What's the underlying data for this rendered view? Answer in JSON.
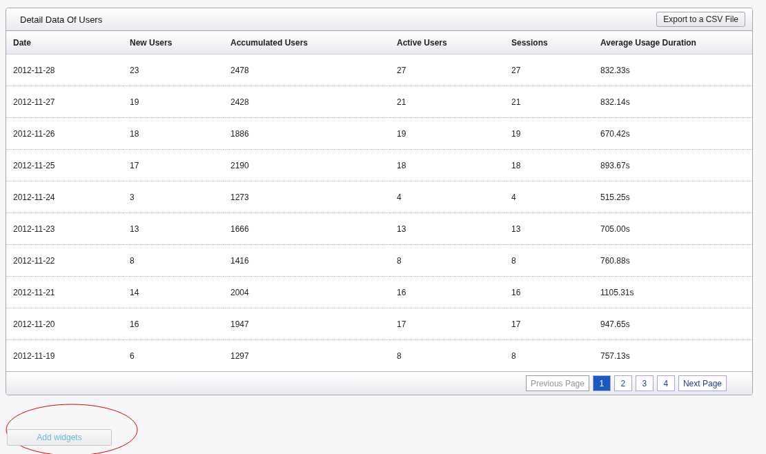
{
  "panel": {
    "title": "Detail Data Of Users",
    "export_button": "Export to a CSV File"
  },
  "table": {
    "columns": [
      "Date",
      "New Users",
      "Accumulated Users",
      "Active Users",
      "Sessions",
      "Average Usage Duration"
    ],
    "rows": [
      [
        "2012-11-28",
        "23",
        "2478",
        "27",
        "27",
        "832.33s"
      ],
      [
        "2012-11-27",
        "19",
        "2428",
        "21",
        "21",
        "832.14s"
      ],
      [
        "2012-11-26",
        "18",
        "1886",
        "19",
        "19",
        "670.42s"
      ],
      [
        "2012-11-25",
        "17",
        "2190",
        "18",
        "18",
        "893.67s"
      ],
      [
        "2012-11-24",
        "3",
        "1273",
        "4",
        "4",
        "515.25s"
      ],
      [
        "2012-11-23",
        "13",
        "1666",
        "13",
        "13",
        "705.00s"
      ],
      [
        "2012-11-22",
        "8",
        "1416",
        "8",
        "8",
        "760.88s"
      ],
      [
        "2012-11-21",
        "14",
        "2004",
        "16",
        "16",
        "1105.31s"
      ],
      [
        "2012-11-20",
        "16",
        "1947",
        "17",
        "17",
        "947.65s"
      ],
      [
        "2012-11-19",
        "6",
        "1297",
        "8",
        "8",
        "757.13s"
      ]
    ]
  },
  "pagination": {
    "previous": {
      "label": "Previous Page",
      "disabled": true
    },
    "pages": [
      {
        "label": "1",
        "selected": true
      },
      {
        "label": "2",
        "selected": false
      },
      {
        "label": "3",
        "selected": false
      },
      {
        "label": "4",
        "selected": false
      }
    ],
    "next": {
      "label": "Next Page",
      "disabled": false
    }
  },
  "add_widgets_button": "Add widgets"
}
